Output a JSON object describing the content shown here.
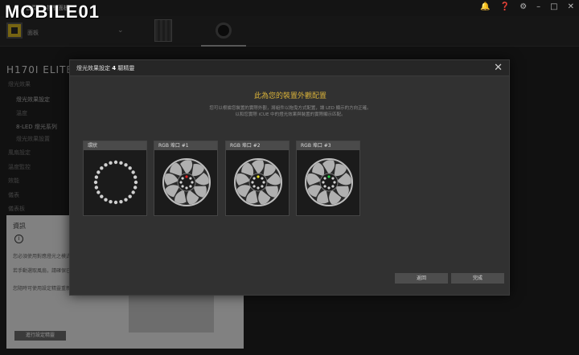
{
  "app": {
    "logo_text": "MOBILE01",
    "menu": [
      "首頁",
      "控制面板"
    ],
    "window_icons": [
      "bell-icon",
      "help-icon",
      "gear-icon",
      "minimize-icon",
      "maximize-icon",
      "close-icon"
    ]
  },
  "device_strip": {
    "device_label": "面板"
  },
  "side": {
    "title": "H170I ELITE L",
    "nav": [
      "燈光效果",
      "燈光效果設定",
      "溫度",
      "8-LED 燈光系列",
      "燈光效果設置",
      "風扇設定",
      "溫度監控",
      "效能",
      "儀表",
      "儀表板"
    ],
    "info": {
      "title": "資訊",
      "lines": [
        "您必須使用對應燈光之模式",
        "若手動選取風扇，請確保已",
        "您隨時可使用設定精靈重新"
      ],
      "button": "進行設定精靈"
    }
  },
  "modal": {
    "title_prefix": "燈光效果設定",
    "title_number": "4",
    "title_suffix": "驅精靈",
    "heading": "此為您的裝置外觀配置",
    "desc_line1": "您可以根據您裝置的實際外觀，將組件以拖曳方式配置，讓 LED 顯示的方向正確。",
    "desc_line2": "以和您實際 iCUE 中的燈光效果與裝置的實際顯示匹配。",
    "cards": [
      {
        "label": "環狀",
        "type": "ring",
        "dot_color": ""
      },
      {
        "label": "RGB 埠口 #1",
        "type": "fan",
        "dot_color": "#e02020"
      },
      {
        "label": "RGB 埠口 #2",
        "type": "fan",
        "dot_color": "#e8e020"
      },
      {
        "label": "RGB 埠口 #3",
        "type": "fan",
        "dot_color": "#20d040"
      }
    ],
    "back_button": "返回",
    "finish_button": "完成"
  }
}
